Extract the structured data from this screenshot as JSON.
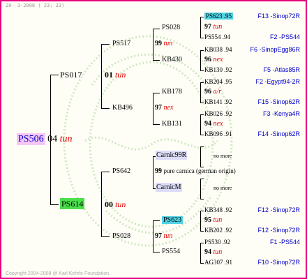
{
  "header": {
    "date": "20- 3-2008 ( 23: 33)"
  },
  "footer": {
    "copyright": "Copyright 2004-2008 @ Karl Kehrle Foundation."
  },
  "root": {
    "id": "PS506",
    "year": "04",
    "mark": "tun"
  },
  "gen1": {
    "top": {
      "id": "PS017",
      "year": "01",
      "mark": "tun"
    },
    "bottom": {
      "id": "PS614",
      "year": "00",
      "mark": "tun"
    }
  },
  "gen2": {
    "ps517": {
      "id": "PS517",
      "year": "99",
      "mark": "tun"
    },
    "kb496": {
      "id": "KB496",
      "year": "97",
      "mark": "nex"
    },
    "ps642": {
      "id": "PS642",
      "year": "99",
      "mark": "pure carnica (german origin)"
    },
    "ps028": {
      "id": "PS028",
      "year": "97",
      "mark": "tun"
    }
  },
  "gen3": {
    "ps028": "PS028",
    "kb430": "KB430",
    "kb178": "KB178",
    "kb131": "KB131",
    "carnic99r": "Carnic99R",
    "carnicm": "CarnicM",
    "ps623": "PS623",
    "ps554": "PS554"
  },
  "gen4": {
    "g1": {
      "top": "PS623 .95",
      "year": "97",
      "mark": "tun",
      "bottom": "PS554 .94"
    },
    "g2": {
      "top": "KB038 .94",
      "year": "96",
      "mark": "nex",
      "bottom": "KB130 .92"
    },
    "g3": {
      "top": "KB204 .95",
      "year": "96",
      "mark": "a/r",
      "bottom": "KB141 .92"
    },
    "g4": {
      "top": "KB026 .92",
      "year": "94",
      "mark": "nex",
      "bottom": "KB096 .91"
    },
    "g5": {
      "nomore": "no more"
    },
    "g6": {
      "nomore": "no more"
    },
    "g7": {
      "top": "KB348 .92",
      "year": "95",
      "mark": "tun",
      "bottom": "KB202 .92"
    },
    "g8": {
      "top": "PS530 .92",
      "year": "94",
      "mark": "tun",
      "bottom": "AG307 .91"
    }
  },
  "links": {
    "g1_top": "F13 -Sinop72R",
    "g1_bottom": "F2 -PS544",
    "g2_top": "F6 -SinopEgg86R",
    "g2_bottom": "F5 -Atlas85R",
    "g3_top": "F2 -Egypt94-2R",
    "g3_bottom": "F15 -Sinop62R",
    "g4_top": "F3 -Kenya4R",
    "g4_bottom": "F14 -Sinop62R",
    "g7_top": "F12 -Sinop72R",
    "g7_bottom": "F12 -Sinop72R",
    "g8_top": "F1 -PS544",
    "g8_bottom": "F10 -Sinop72R"
  },
  "colors": {
    "border": "#e6007e",
    "highlight_cyan": "#4fd2e4",
    "root_bg": "#f6c7f6",
    "dam_bg": "#4be04b",
    "link": "#0000cc",
    "mark": "#dd0000"
  }
}
